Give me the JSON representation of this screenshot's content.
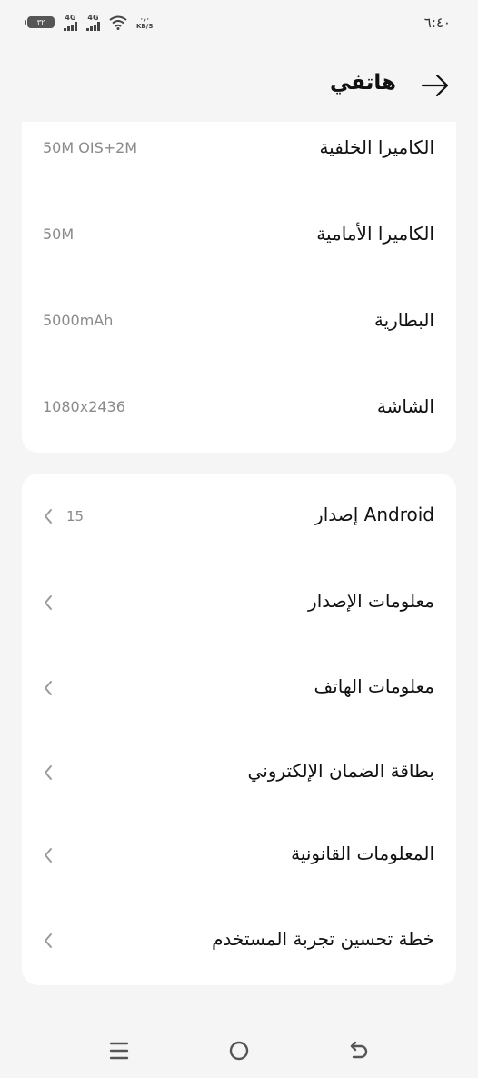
{
  "status_bar": {
    "time": "٦:٤٠",
    "battery": "٣٢",
    "network_1": "4G",
    "network_2": "4G",
    "speed_unit": "KB/S",
    "speed_value": "٠٫٠"
  },
  "header": {
    "title": "هاتفي"
  },
  "specs": [
    {
      "label": "الكاميرا الخلفية",
      "value": "50M OIS+2M"
    },
    {
      "label": "الكاميرا الأمامية",
      "value": "50M"
    },
    {
      "label": "البطارية",
      "value": "5000mAh"
    },
    {
      "label": "الشاشة",
      "value": "1080x2436"
    }
  ],
  "menu": [
    {
      "label": "إصدار Android",
      "value": "15"
    },
    {
      "label": "معلومات الإصدار"
    },
    {
      "label": "معلومات الهاتف"
    },
    {
      "label": "بطاقة الضمان الإلكتروني"
    },
    {
      "label": "المعلومات القانونية"
    },
    {
      "label": "خطة تحسين تجربة المستخدم"
    }
  ],
  "nav": {
    "icons": [
      "menu-icon",
      "home-icon",
      "back-gesture-icon"
    ]
  },
  "colors": {
    "background": "#f5f5f5",
    "card": "#ffffff",
    "secondary_text": "#8a8a8a"
  }
}
